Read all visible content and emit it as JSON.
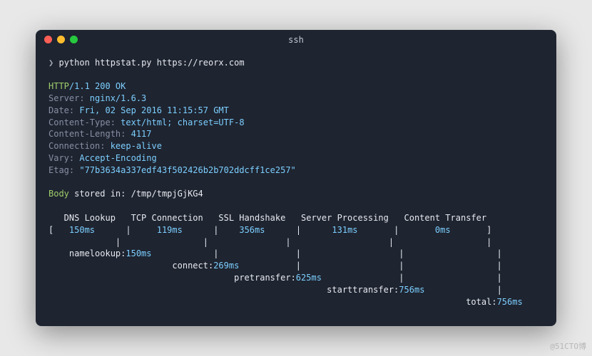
{
  "titlebar": {
    "title": "ssh"
  },
  "prompt": {
    "symbol": "❯",
    "command": "python httpstat.py https://reorx.com"
  },
  "response": {
    "protocol": "HTTP",
    "status": "/1.1 200 OK",
    "headers": [
      {
        "key": "Server:",
        "value": " nginx/1.6.3"
      },
      {
        "key": "Date:",
        "value": " Fri, 02 Sep 2016 11:15:57 GMT"
      },
      {
        "key": "Content-Type:",
        "value": " text/html; charset=UTF-8"
      },
      {
        "key": "Content-Length:",
        "value": " 4117"
      },
      {
        "key": "Connection:",
        "value": " keep-alive"
      },
      {
        "key": "Vary:",
        "value": " Accept-Encoding"
      },
      {
        "key": "Etag:",
        "value": " \"77b3634a337edf43f502426b2b702ddcff1ce257\""
      }
    ]
  },
  "body": {
    "label": "Body",
    "rest": " stored in: /tmp/tmpjGjKG4"
  },
  "timing": {
    "header": "   DNS Lookup   TCP Connection   SSL Handshake   Server Processing   Content Transfer",
    "values": {
      "open": "[   ",
      "dns": "150ms",
      "s1": "      |     ",
      "tcp": "119ms",
      "s2": "      |    ",
      "ssl": "356ms",
      "s3": "      |      ",
      "srv": "131ms",
      "s4": "       |       ",
      "ct": "0ms",
      "close": "       ]"
    },
    "bars": "             |                |               |                   |                  |",
    "nl_lbl": "    namelookup:",
    "nl_val": "150ms",
    "nl_bars": "            |               |                   |                  |",
    "cn_pad": "                        ",
    "cn_lbl": "connect:",
    "cn_val": "269ms",
    "cn_bars": "           |                   |                  |",
    "pt_pad": "                                    ",
    "pt_lbl": "pretransfer:",
    "pt_val": "625ms",
    "pt_bars": "               |                  |",
    "st_pad": "                                                      ",
    "st_lbl": "starttransfer:",
    "st_val": "756ms",
    "st_bars": "              |",
    "tt_pad": "                                                                                 ",
    "tt_lbl": "total:",
    "tt_val": "756ms"
  },
  "watermark": "@51CTO博"
}
